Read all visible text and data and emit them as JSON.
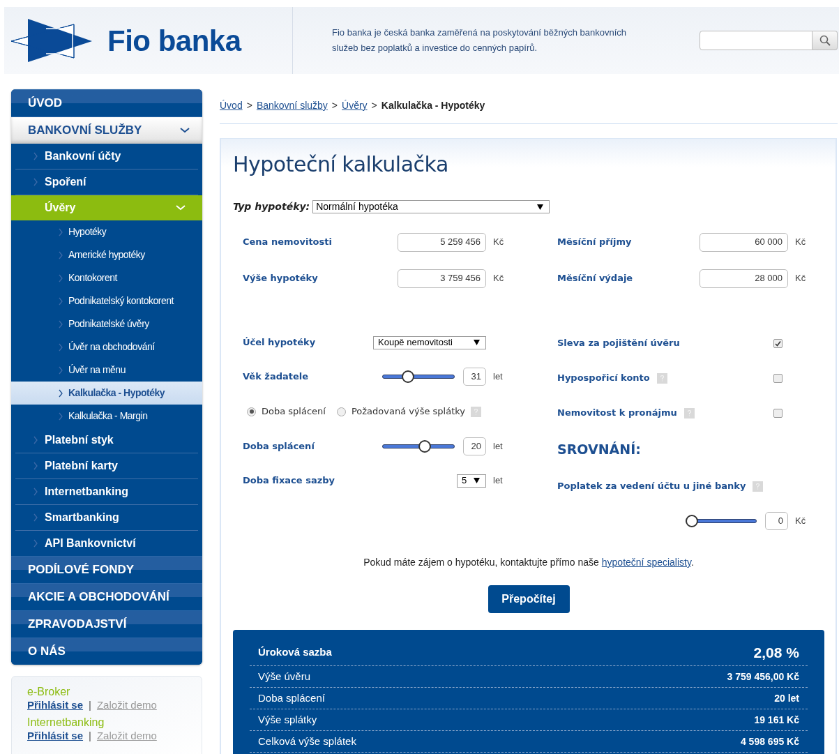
{
  "header": {
    "logo_text": "Fio banka",
    "tagline": "Fio banka je česká banka zaměřená na poskytování běžných bankovních služeb bez poplatků a investice do cenných papírů."
  },
  "sidebar": {
    "menu": [
      {
        "label": "ÚVOD",
        "expanded": false
      },
      {
        "label": "BANKOVNÍ SLUŽBY",
        "expanded": true,
        "children": [
          {
            "label": "Bankovní účty",
            "expanded": false
          },
          {
            "label": "Spoření",
            "expanded": false
          },
          {
            "label": "Úvěry",
            "expanded": true,
            "children": [
              {
                "label": "Hypotéky",
                "selected": false
              },
              {
                "label": "Americké hypotéky",
                "selected": false
              },
              {
                "label": "Kontokorent",
                "selected": false
              },
              {
                "label": "Podnikatelský kontokorent",
                "selected": false
              },
              {
                "label": "Podnikatelské úvěry",
                "selected": false
              },
              {
                "label": "Úvěr na obchodování",
                "selected": false
              },
              {
                "label": "Úvěr na měnu",
                "selected": false
              },
              {
                "label": "Kalkulačka - Hypotéky",
                "selected": true
              },
              {
                "label": "Kalkulačka - Margin",
                "selected": false
              }
            ]
          },
          {
            "label": "Platební styk",
            "expanded": false
          },
          {
            "label": "Platební karty",
            "expanded": false
          },
          {
            "label": "Internetbanking",
            "expanded": false
          },
          {
            "label": "Smartbanking",
            "expanded": false
          },
          {
            "label": "API Bankovnictví",
            "expanded": false
          }
        ]
      },
      {
        "label": "PODÍLOVÉ FONDY",
        "expanded": false
      },
      {
        "label": "AKCIE A OBCHODOVÁNÍ",
        "expanded": false
      },
      {
        "label": "ZPRAVODAJSTVÍ",
        "expanded": false
      },
      {
        "label": "O NÁS",
        "expanded": false
      }
    ],
    "login_box": [
      {
        "title": "e-Broker",
        "links": [
          "Přihlásit se",
          "Založit demo"
        ],
        "separator": "|"
      },
      {
        "title": "Internetbanking",
        "links": [
          "Přihlásit se",
          "Založit demo"
        ],
        "separator": "|"
      }
    ]
  },
  "breadcrumb": {
    "separator": ">",
    "items": [
      {
        "label": "Úvod",
        "link": true
      },
      {
        "label": "Bankovní služby",
        "link": true
      },
      {
        "label": "Úvěry",
        "link": true
      },
      {
        "label": "Kalkulačka - Hypotéky",
        "link": false
      }
    ]
  },
  "calculator": {
    "title": "Hypoteční kalkulačka",
    "type_select": {
      "label": "Typ hypotéky:",
      "value": "Normální hypotéka"
    },
    "left_fields": [
      {
        "kind": "input",
        "label": "Cena nemovitosti",
        "value": "5 259 456",
        "unit": "Kč"
      },
      {
        "kind": "input",
        "label": "Výše hypotéky",
        "value": "3 759 456",
        "unit": "Kč"
      },
      {
        "kind": "spacer"
      },
      {
        "kind": "select",
        "label": "Účel hypotéky",
        "value": "Koupě nemovitosti"
      },
      {
        "kind": "slider",
        "label": "Věk žadatele",
        "level": 0.32,
        "value": "31",
        "unit": "let"
      },
      {
        "kind": "radio",
        "options": [
          {
            "label": "Doba splácení",
            "selected": true,
            "help": false
          },
          {
            "label": "Požadovaná výše splátky",
            "selected": false,
            "help": true
          }
        ]
      },
      {
        "kind": "slider",
        "label": "Doba splácení",
        "level": 0.6,
        "value": "20",
        "unit": "let"
      },
      {
        "kind": "select",
        "label": "Doba fixace sazby",
        "value": "5",
        "unit": "let"
      }
    ],
    "right_fields": [
      {
        "kind": "input",
        "label": "Měsíční příjmy",
        "value": "60 000",
        "unit": "Kč"
      },
      {
        "kind": "input",
        "label": "Měsíční výdaje",
        "value": "28 000",
        "unit": "Kč"
      },
      {
        "kind": "spacer"
      },
      {
        "kind": "checkbox",
        "label": "Sleva za pojištění úvěru",
        "checked": true,
        "help": false
      },
      {
        "kind": "checkbox",
        "label": "Hypospořicí konto",
        "checked": false,
        "help": true
      },
      {
        "kind": "checkbox",
        "label": "Nemovitost k pronájmu",
        "checked": false,
        "help": true
      },
      {
        "kind": "heading",
        "label": "SROVNÁNÍ:"
      },
      {
        "kind": "label",
        "label": "Poplatek za vedení účtu u jiné banky",
        "help": true
      },
      {
        "kind": "slider",
        "level": 0.0,
        "value": "0",
        "unit": "Kč"
      }
    ],
    "note": {
      "before": "Pokud máte zájem o hypotéku, kontaktujte přímo naše ",
      "link": "hypoteční specialisty",
      "after": "."
    },
    "button": "Přepočítej",
    "results": [
      {
        "kind": "headline",
        "label": "Úroková sazba",
        "value": "2,08 %"
      },
      {
        "kind": "row",
        "label": "Výše úvěru",
        "value": "3 759 456,00 Kč"
      },
      {
        "kind": "row",
        "label": "Doba splácení",
        "value": "20 let"
      },
      {
        "kind": "row",
        "label": "Výše splátky",
        "value": "19 161 Kč"
      },
      {
        "kind": "row",
        "label": "Celková výše splátek",
        "value": "4 598 695 Kč"
      }
    ]
  }
}
